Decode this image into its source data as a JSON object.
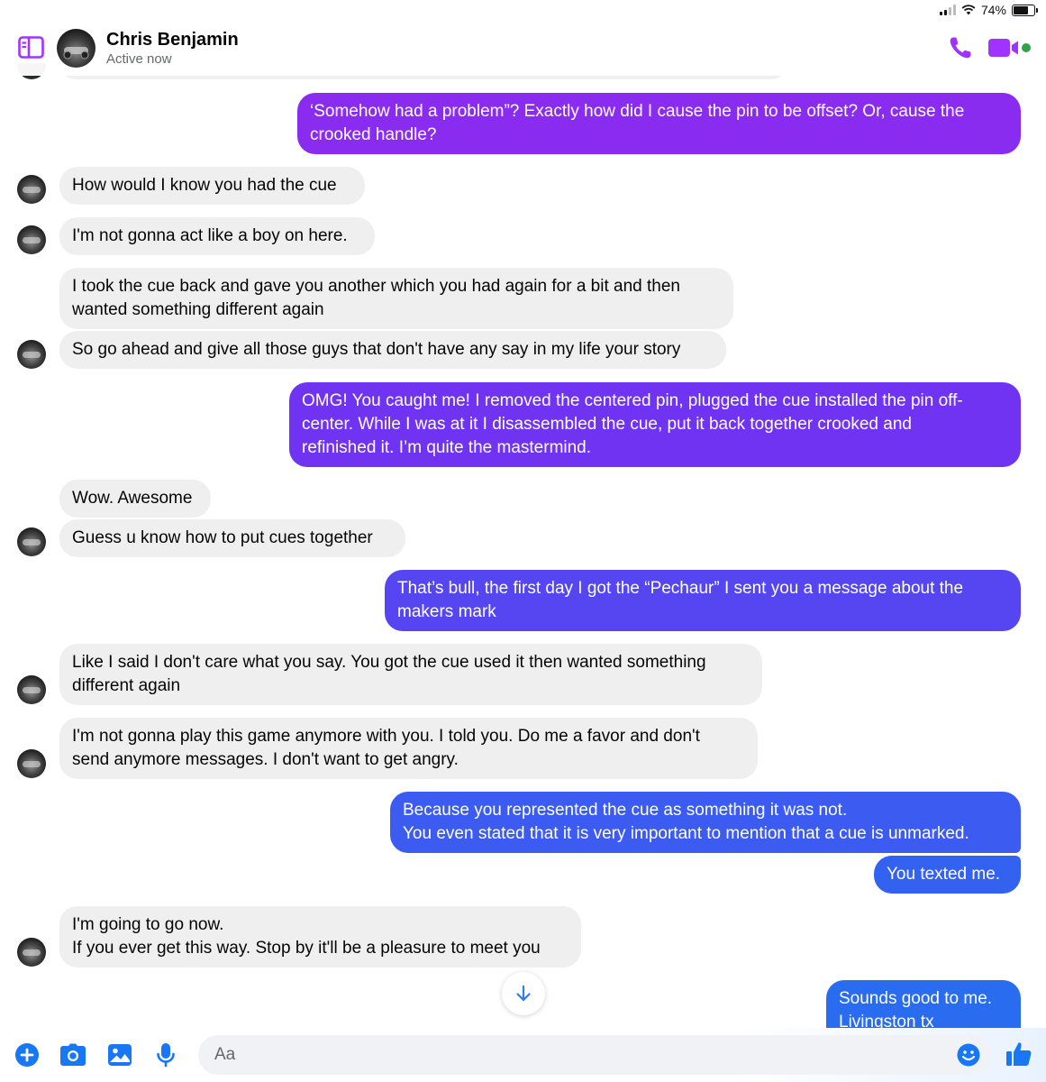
{
  "status_bar": {
    "battery": "74%",
    "battery_level": 0.74
  },
  "header": {
    "name": "Chris Benjamin",
    "status": "Active now"
  },
  "colors": {
    "accent": "#a033ff",
    "incoming_bubble": "#efefef",
    "active_dot": "#31a24c",
    "out_top": "#8a2cf0",
    "out_bottom": "#2a6cf0"
  },
  "messages": [
    {
      "text": "‘Somehow had a problem”? Exactly how did I cause the pin to be offset? Or, cause the\ncrooked handle?"
    },
    {
      "text": "How would I know you had the cue"
    },
    {
      "text": "I'm not gonna act like a boy on here."
    },
    {
      "text": "I took the cue back and gave you another which you had again for a bit and then\nwanted something different again"
    },
    {
      "text": "So go ahead and give all those guys that don't have any say in my life your story"
    },
    {
      "text": "OMG! You caught me! I removed the centered pin, plugged the cue installed the pin off-\ncenter. While I was at it I disassembled the cue, put it back together crooked and\nrefinished it. I’m quite the mastermind."
    },
    {
      "text": "Wow. Awesome"
    },
    {
      "text": "Guess u know how to put cues together"
    },
    {
      "text": "That’s bull, the first day I got the “Pechaur” I sent you a message about the\nmakers mark"
    },
    {
      "text": "Like I said I don't care what you say. You got the cue used it then wanted something\ndifferent again"
    },
    {
      "text": "I'm not gonna play this game anymore with you.  I told you. Do me a favor and don't\nsend anymore messages. I don't want to get angry."
    },
    {
      "text": "Because you represented the cue as something it was not.\nYou even stated that it is very important to mention that a cue is unmarked."
    },
    {
      "text": "You texted me."
    },
    {
      "text": "I'm going to go now.\nIf you ever get this way. Stop by it'll be a pleasure to meet you"
    },
    {
      "text": "Sounds good to me.\nLivingston tx"
    }
  ],
  "composer": {
    "placeholder": "Aa"
  }
}
